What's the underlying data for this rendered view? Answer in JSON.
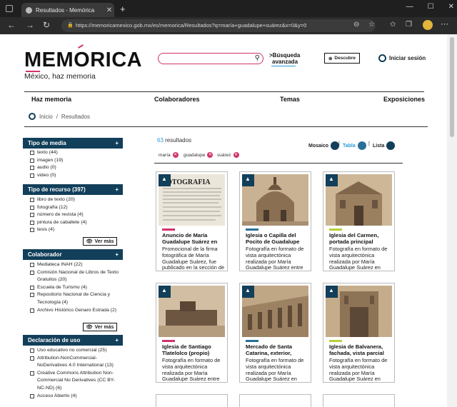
{
  "browser": {
    "tab_title": "Resultados - Memórica",
    "url": "https://memoricamexico.gob.mx/es/memorica/Resultados?q=maría+guadalupe+suárez&x=0&y=0"
  },
  "header": {
    "logo": "MEMORICA",
    "tagline": "México, haz memoria",
    "search_value": "",
    "advanced_line1": ">Búsqueda",
    "advanced_line2": "avanzada",
    "descubre": "Descubre",
    "login": "Iniciar sesión"
  },
  "nav": [
    "Haz memoria",
    "Colaboradores",
    "Temas",
    "Exposiciones"
  ],
  "breadcrumb": [
    "Inicio",
    "/",
    "Resultados"
  ],
  "facets": {
    "media_title": "Tipo de media",
    "media_items": [
      "texto (44)",
      "imagen (19)",
      "audio (0)",
      "video (0)"
    ],
    "resource_title": "Tipo de recurso (397)",
    "resource_items": [
      "libro de texto (20)",
      "fotografía (12)",
      "número de revista (4)",
      "pintura de caballete (4)",
      "tesis (4)"
    ],
    "vermas": "Ver más",
    "collab_title": "Colaborador",
    "collab_items": [
      "Mediateca INAH (22)",
      "Comisión Nacional de Libros de Texto Gratuitos (20)",
      "Escuela de Turismo (4)",
      "Repositorio Nacional de Ciencia y Tecnología (4)",
      "Archivo Histórico Genaro Estrada (2)"
    ],
    "license_title": "Declaración de uso",
    "license_items": [
      "Uso educativo no comercial (25)",
      "Attribution-NonCommercial-NoDerivatives 4.0 International (13)",
      "Creative Commons Attribution Non-Commercial No Derivatives (CC BY-NC-ND) (6)",
      "Acceso Abierto (4)"
    ]
  },
  "results": {
    "count_num": "63",
    "count_label": " resultados",
    "views": {
      "mosaic": "Mosaico",
      "table": "Tabla",
      "list": "Lista"
    },
    "chips": [
      "maría",
      "guadalupe",
      "suárez"
    ],
    "cards": [
      {
        "title": "Anuncio de María Guadalupe Suárez en",
        "desc": "Promocional de la firma fotográfica de María Guadalupe Suárez, fue publicado en la sección de",
        "accent": "#d1336c"
      },
      {
        "title": "Iglesia o Capilla del Pocito de Guadalupe",
        "desc": "Fotografía en formato de vista arquitectónica realizada por María Guadalupe Suárez entre",
        "accent": "#2a6f97"
      },
      {
        "title": "Iglesia del Carmen, portada principal",
        "desc": "Fotografía en formato de vista arquitectónica realizada por María Guadalupe Suárez en",
        "accent": "#b9cf3a"
      },
      {
        "title": "Iglesia de Santiago Tlatelolco (propio)",
        "desc": "Fotografía en formato de vista arquitectónica realizada por María Guadalupe Suárez entre",
        "accent": "#d1336c"
      },
      {
        "title": "Mercado de Santa Catarina, exterior,",
        "desc": "Fotografía en formato de vista arquitectónica realizada por María Guadalupe Suárez en",
        "accent": "#2a6f97"
      },
      {
        "title": "Iglesia de Balvanera, fachada, vista parcial",
        "desc": "Fotografía en formato de vista arquitectónica realizada por María Guadalupe Suárez en",
        "accent": "#b9cf3a"
      }
    ]
  }
}
